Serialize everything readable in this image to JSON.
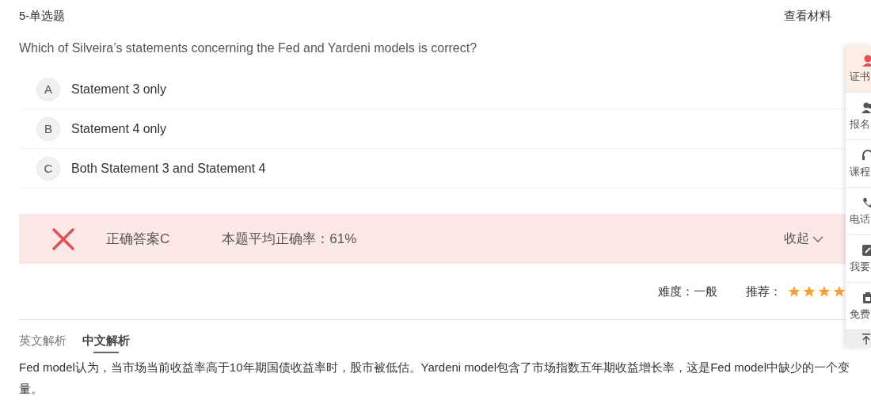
{
  "header": {
    "question_type": "5-单选题",
    "view_material": "查看材料"
  },
  "question": "Which of Silveira’s statements concerning the Fed and Yardeni models is correct?",
  "options": [
    {
      "letter": "A",
      "text": "Statement 3 only",
      "selected": false
    },
    {
      "letter": "B",
      "text": "Statement 4 only",
      "selected": false
    },
    {
      "letter": "C",
      "text": "Both Statement 3 and Statement 4",
      "selected": false
    }
  ],
  "result": {
    "correct": false,
    "correct_answer": "正确答案C",
    "average_rate": "本题平均正确率：61%",
    "collapse": "收起"
  },
  "meta": {
    "difficulty": "难度：一般",
    "recommend": "推荐：",
    "stars": 4
  },
  "analysis_tabs": [
    {
      "label": "英文解析",
      "selected": false
    },
    {
      "label": "中文解析",
      "selected": true
    }
  ],
  "analysis": "Fed model认为，当市场当前收益率高于10年期国债收益率时，股市被低估。Yardeni model包含了市场指数五年期收益增长率，这是Fed model中缺少的一个变量。",
  "sidebar": [
    {
      "kind": "agent",
      "label": "证书",
      "selected": true
    },
    {
      "kind": "people",
      "label": "报名",
      "selected": false
    },
    {
      "kind": "headset",
      "label": "课程",
      "selected": false
    },
    {
      "kind": "phone",
      "label": "电话",
      "selected": false
    },
    {
      "kind": "edit",
      "label": "我要",
      "selected": false
    },
    {
      "kind": "clipboard",
      "label": "免费",
      "selected": false
    }
  ]
}
